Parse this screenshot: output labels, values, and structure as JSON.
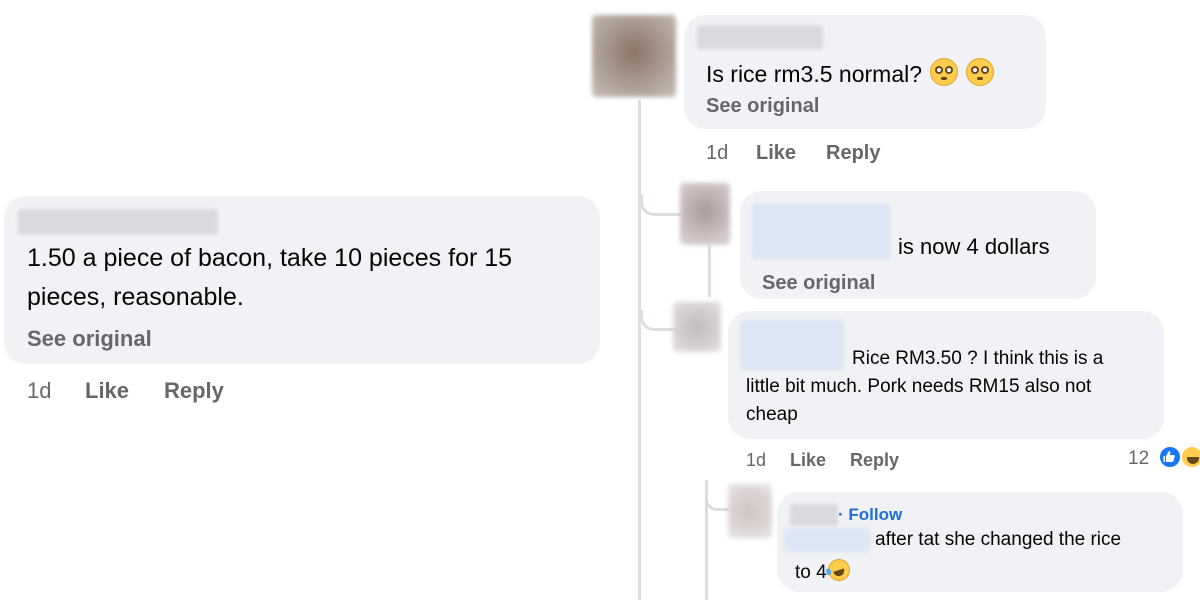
{
  "left_comment": {
    "text_line1": "1.50 a piece of bacon, take 10 pieces for 15",
    "text_line2": "pieces, reasonable.",
    "see_original": "See original",
    "time": "1d",
    "like": "Like",
    "reply": "Reply"
  },
  "top_comment": {
    "text": "Is rice rm3.5 normal?",
    "see_original": "See original",
    "time": "1d",
    "like": "Like",
    "reply": "Reply"
  },
  "reply1": {
    "text": "is now 4 dollars",
    "see_original": "See original"
  },
  "reply2": {
    "line1": "Rice RM3.50 ?  I think this is a",
    "line2": "little bit much. Pork needs RM15 also not",
    "line3": "cheap",
    "time": "1d",
    "like": "Like",
    "reply": "Reply",
    "reaction_count": "12"
  },
  "reply3": {
    "follow": "Follow",
    "line1": "after tat she changed the rice",
    "line2": "to 4"
  },
  "colors": {
    "bubble": "#f0f2f5",
    "secondary_text": "#65676b",
    "link_blue": "#216fdb",
    "like_blue": "#1877f2"
  }
}
